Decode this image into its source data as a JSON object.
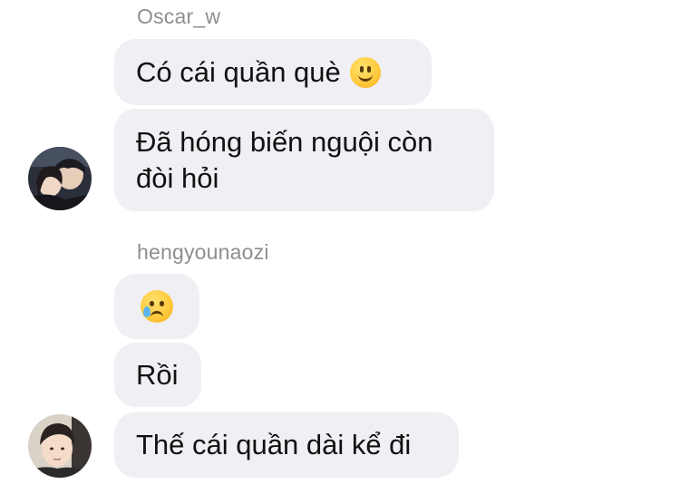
{
  "conversation": {
    "groups": [
      {
        "sender": "Oscar_w",
        "messages": [
          {
            "text": "Có cái quần què",
            "emoji": "slightly-smiling-face-icon"
          },
          {
            "text": "Đã hóng biến nguội còn\nđòi hỏi"
          }
        ],
        "avatar": "avatar-couple-photo"
      },
      {
        "sender": "hengyounaozi",
        "messages": [
          {
            "text": "",
            "emoji": "crying-face-icon"
          },
          {
            "text": "Rồi"
          },
          {
            "text": "Thế cái quần dài kể đi"
          }
        ],
        "avatar": "avatar-young-man-photo"
      }
    ]
  },
  "colors": {
    "bubble_bg": "#efeff4",
    "sender_name": "#8e8e93",
    "message_text": "#111111"
  }
}
